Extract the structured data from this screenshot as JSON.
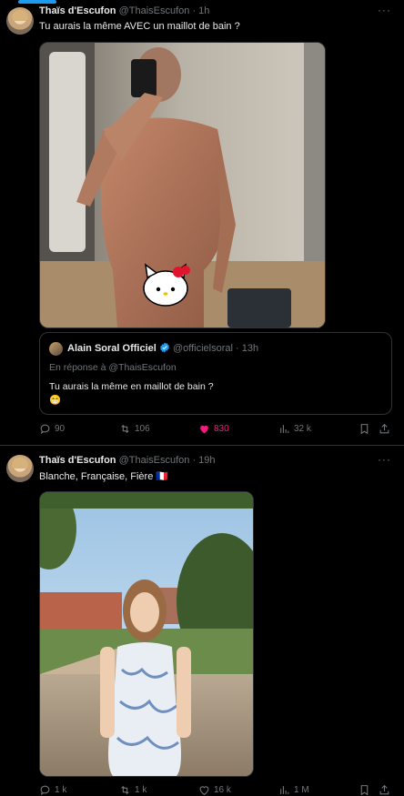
{
  "tweet1": {
    "author_name": "Thaïs d'Escufon",
    "handle": "@ThaisEscufon",
    "time": "· 1h",
    "more": "···",
    "text": "Tu aurais la même AVEC un maillot de bain ?",
    "media_sticker": "hello-kitty-sticker",
    "quote": {
      "author_name": "Alain Soral Officiel",
      "handle": "@officielsoral",
      "time": "· 13h",
      "reply_to": "En réponse à @ThaisEscufon",
      "text": "Tu aurais la même en maillot de bain ?",
      "emoji": "😁"
    },
    "stats": {
      "replies": "90",
      "retweets": "106",
      "likes": "830",
      "views": "32 k"
    }
  },
  "tweet2": {
    "author_name": "Thaïs d'Escufon",
    "handle": "@ThaisEscufon",
    "time": "· 19h",
    "more": "···",
    "text": "Blanche, Française, Fière 🇫🇷",
    "stats": {
      "replies": "1 k",
      "retweets": "1 k",
      "likes": "16 k",
      "views": "1 M"
    }
  },
  "colors": {
    "background": "#000000",
    "text": "#e7e9ea",
    "muted": "#71767b",
    "accent": "#1d9bf0",
    "like": "#f91880",
    "divider": "#2f3336"
  },
  "icons": [
    "reply-icon",
    "retweet-icon",
    "heart-icon",
    "views-icon",
    "bookmark-icon",
    "share-icon",
    "verified-icon",
    "more-icon"
  ]
}
